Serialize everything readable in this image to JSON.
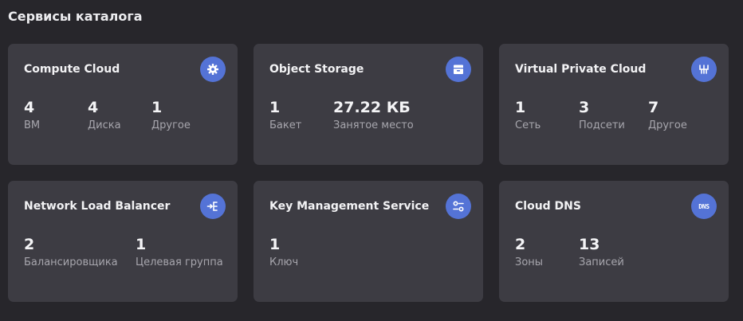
{
  "page_title": "Сервисы каталога",
  "cards": [
    {
      "title": "Compute Cloud",
      "icon": "gear-icon",
      "stats": [
        {
          "value": "4",
          "label": "ВМ"
        },
        {
          "value": "4",
          "label": "Диска"
        },
        {
          "value": "1",
          "label": "Другое"
        }
      ]
    },
    {
      "title": "Object Storage",
      "icon": "storage-icon",
      "stats": [
        {
          "value": "1",
          "label": "Бакет"
        },
        {
          "value": "27.22 КБ",
          "label": "Занятое место"
        }
      ]
    },
    {
      "title": "Virtual Private Cloud",
      "icon": "network-icon",
      "stats": [
        {
          "value": "1",
          "label": "Сеть"
        },
        {
          "value": "3",
          "label": "Подсети"
        },
        {
          "value": "7",
          "label": "Другое"
        }
      ]
    },
    {
      "title": "Network Load Balancer",
      "icon": "load-balancer-icon",
      "stats": [
        {
          "value": "2",
          "label": "Балансировщика"
        },
        {
          "value": "1",
          "label": "Целевая группа"
        }
      ]
    },
    {
      "title": "Key Management Service",
      "icon": "key-icon",
      "stats": [
        {
          "value": "1",
          "label": "Ключ"
        }
      ]
    },
    {
      "title": "Cloud DNS",
      "icon": "dns-icon",
      "icon_text": "DNS",
      "stats": [
        {
          "value": "2",
          "label": "Зоны"
        },
        {
          "value": "13",
          "label": "Записей"
        }
      ]
    }
  ],
  "colors": {
    "background": "#27262b",
    "card": "#3d3c43",
    "accent": "#5473d6",
    "label": "#a7a6ad"
  }
}
